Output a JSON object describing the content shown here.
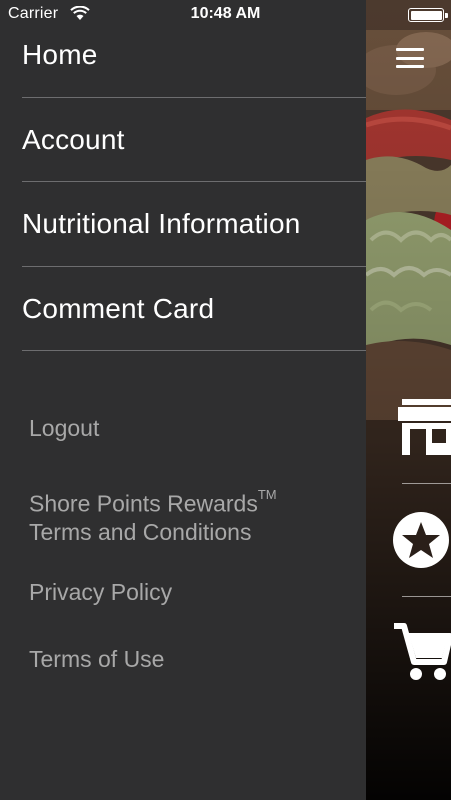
{
  "status_bar": {
    "carrier": "Carrier",
    "time": "10:48 AM"
  },
  "drawer": {
    "main_items": [
      {
        "label": "Home"
      },
      {
        "label": "Account"
      },
      {
        "label": "Nutritional Information"
      },
      {
        "label": "Comment Card"
      }
    ],
    "links": {
      "logout": "Logout",
      "rewards_terms_line1": "Shore Points Rewards",
      "rewards_terms_tm": "TM",
      "rewards_terms_line2": "Terms and Conditions",
      "privacy": "Privacy Policy",
      "terms_of_use": "Terms of Use"
    }
  },
  "background_app": {
    "icons": [
      "menu-icon",
      "store-icon",
      "star-icon",
      "cart-icon"
    ]
  },
  "colors": {
    "drawer_bg": "#2f2f30",
    "divider": "#6d6d6f",
    "primary_text": "#ffffff",
    "secondary_text": "#a8a8a8"
  }
}
